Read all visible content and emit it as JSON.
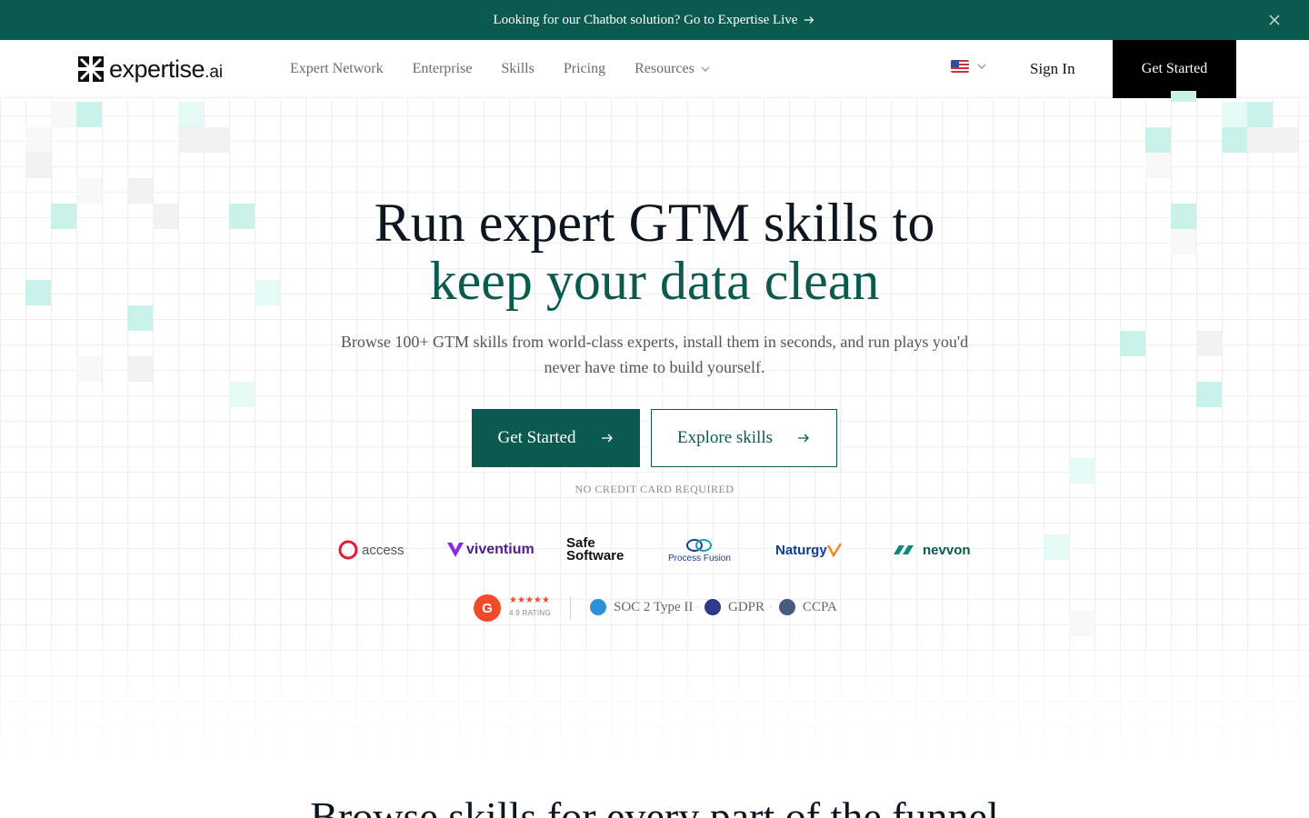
{
  "announcement": {
    "text": "Looking for our Chatbot solution? Go to Expertise Live"
  },
  "nav": {
    "logo_word": "expertise",
    "logo_suffix": ".ai",
    "items": [
      {
        "label": "Expert Network"
      },
      {
        "label": "Enterprise"
      },
      {
        "label": "Skills"
      },
      {
        "label": "Pricing"
      },
      {
        "label": "Resources"
      }
    ],
    "sign_in": "Sign In",
    "get_started": "Get Started"
  },
  "hero": {
    "headline_line1": "Run expert GTM skills to",
    "headline_line2": "keep your data clean",
    "subtitle": "Browse 100+ GTM skills from world-class experts, install them in seconds, and run plays you'd never have time to build yourself.",
    "primary_cta": "Get Started",
    "secondary_cta": "Explore skills",
    "note": "NO CREDIT CARD REQUIRED"
  },
  "customer_logos": [
    {
      "name": "access"
    },
    {
      "name": "viventium"
    },
    {
      "name_line1": "Safe",
      "name_line2": "Software"
    },
    {
      "name": "Process Fusion"
    },
    {
      "name": "Naturgy"
    },
    {
      "name": "nevvon"
    }
  ],
  "trust": {
    "g2_letter": "G",
    "stars": "★★★★★",
    "rating_text": "4.9 RATING",
    "badges": [
      {
        "label": "SOC 2 Type II"
      },
      {
        "label": "GDPR"
      },
      {
        "label": "CCPA"
      }
    ]
  },
  "next_section_title": "Browse skills for every part of the funnel",
  "colors": {
    "brand_green": "#0b5a4f",
    "black": "#000000",
    "g2_red": "#ef4b2b"
  }
}
